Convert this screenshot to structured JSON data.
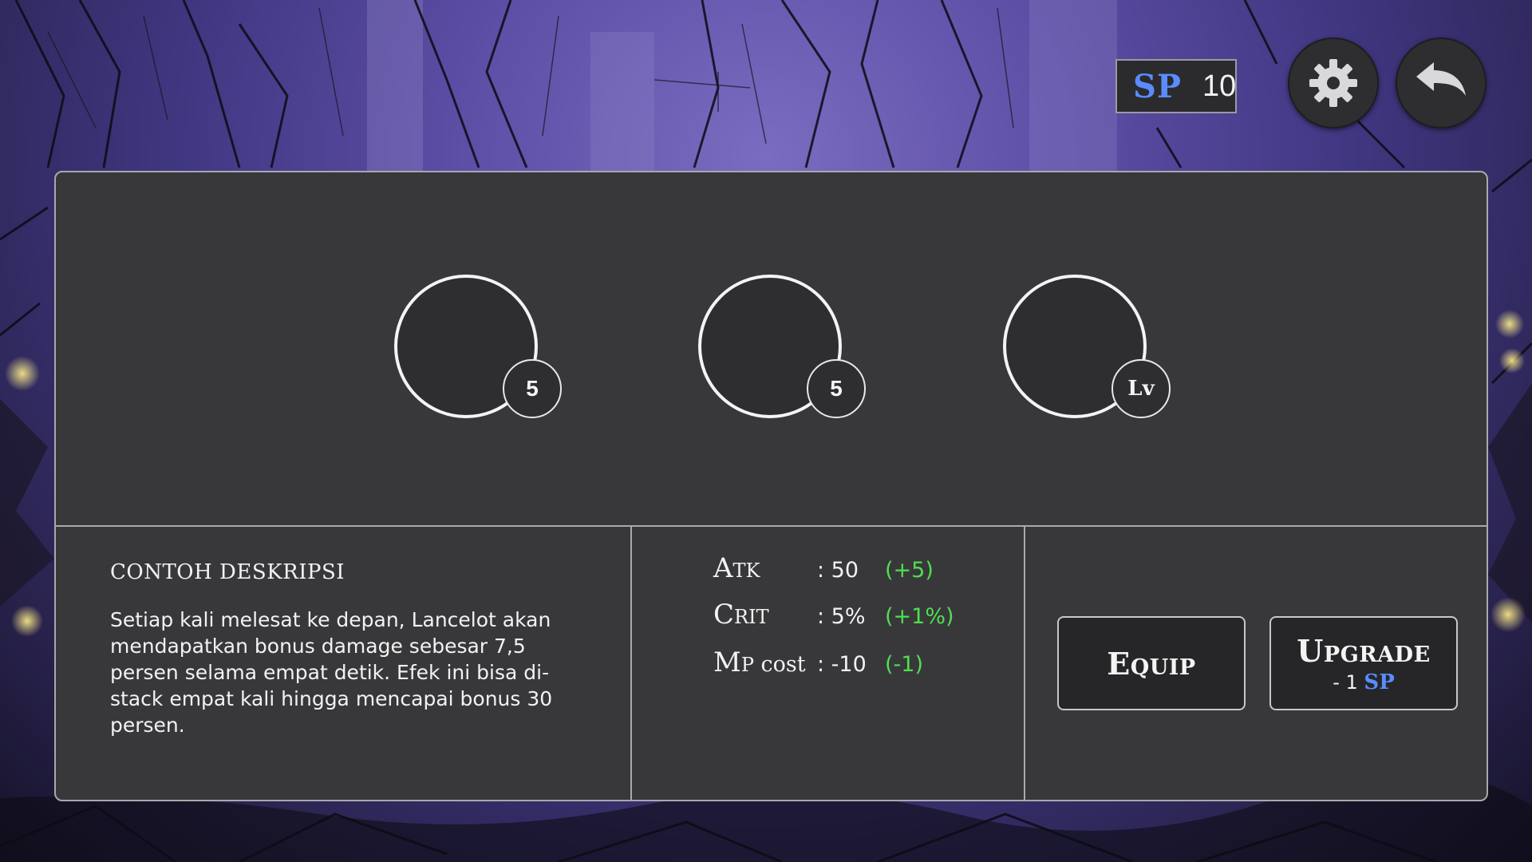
{
  "hud": {
    "sp_label": "SP",
    "sp_value": "10",
    "settings_icon": "gear-icon",
    "back_icon": "undo-arrow-icon"
  },
  "skills": [
    {
      "badge": "5"
    },
    {
      "badge": "5"
    },
    {
      "badge": "Lv"
    }
  ],
  "description": {
    "title": "CONTOH DESKRIPSI",
    "body": "Setiap kali melesat ke depan, Lancelot akan mendapatkan bonus damage sebesar 7,5 persen selama empat detik. Efek ini bisa di-stack empat kali hingga mencapai bonus 30 persen."
  },
  "stats": [
    {
      "name": "Atk",
      "value": ": 50",
      "bonus": "(+5)"
    },
    {
      "name": "Crit",
      "value": ": 5%",
      "bonus": "(+1%)"
    },
    {
      "name": "Mp",
      "name_suffix": " cost",
      "value": ": -10",
      "bonus": "(-1)"
    }
  ],
  "actions": {
    "equip_label": "Equip",
    "upgrade_label": "Upgrade",
    "upgrade_cost_prefix": "- 1 ",
    "upgrade_cost_unit": "SP"
  },
  "colors": {
    "sp_accent": "#5a8cff",
    "bonus_green": "#4ee04e",
    "panel_bg": "#38383b"
  }
}
